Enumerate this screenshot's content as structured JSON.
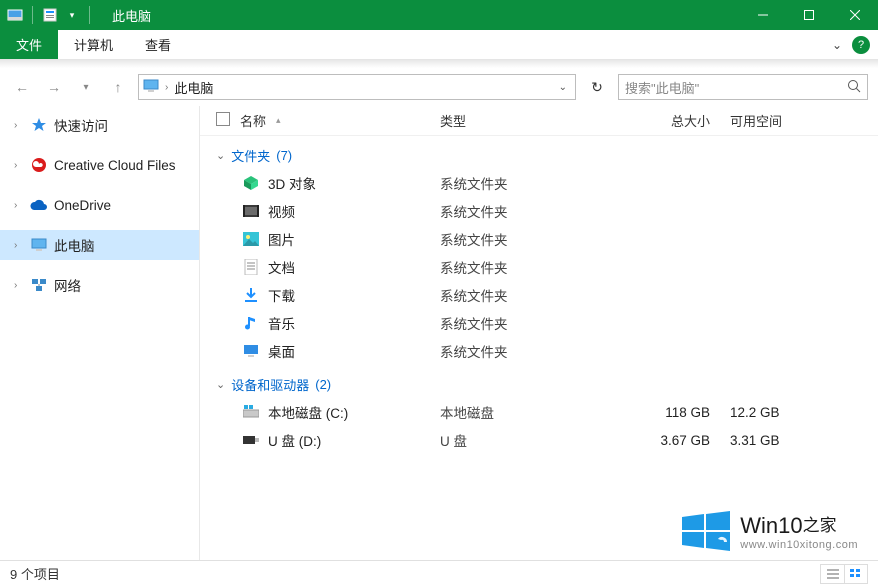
{
  "window": {
    "title": "此电脑"
  },
  "ribbon": {
    "file": "文件",
    "computer": "计算机",
    "view": "查看"
  },
  "nav": {
    "back": "←",
    "forward": "→",
    "up": "↑"
  },
  "address": {
    "path": "此电脑"
  },
  "search": {
    "placeholder": "搜索\"此电脑\""
  },
  "columns": {
    "name": "名称",
    "type": "类型",
    "totalsize": "总大小",
    "freespace": "可用空间"
  },
  "sidebar": {
    "quickaccess": "快速访问",
    "creativecloud": "Creative Cloud Files",
    "onedrive": "OneDrive",
    "thispc": "此电脑",
    "network": "网络"
  },
  "groups": {
    "folders": {
      "label": "文件夹",
      "count": "(7)"
    },
    "drives": {
      "label": "设备和驱动器",
      "count": "(2)"
    }
  },
  "folders": [
    {
      "name": "3D 对象",
      "type": "系统文件夹"
    },
    {
      "name": "视频",
      "type": "系统文件夹"
    },
    {
      "name": "图片",
      "type": "系统文件夹"
    },
    {
      "name": "文档",
      "type": "系统文件夹"
    },
    {
      "name": "下载",
      "type": "系统文件夹"
    },
    {
      "name": "音乐",
      "type": "系统文件夹"
    },
    {
      "name": "桌面",
      "type": "系统文件夹"
    }
  ],
  "drives": [
    {
      "name": "本地磁盘 (C:)",
      "type": "本地磁盘",
      "size": "118 GB",
      "free": "12.2 GB"
    },
    {
      "name": "U 盘 (D:)",
      "type": "U 盘",
      "size": "3.67 GB",
      "free": "3.31 GB"
    }
  ],
  "status": {
    "items": "9 个项目"
  },
  "watermark": {
    "brand_a": "Win10",
    "brand_b": "之家",
    "url": "www.win10xitong.com"
  }
}
